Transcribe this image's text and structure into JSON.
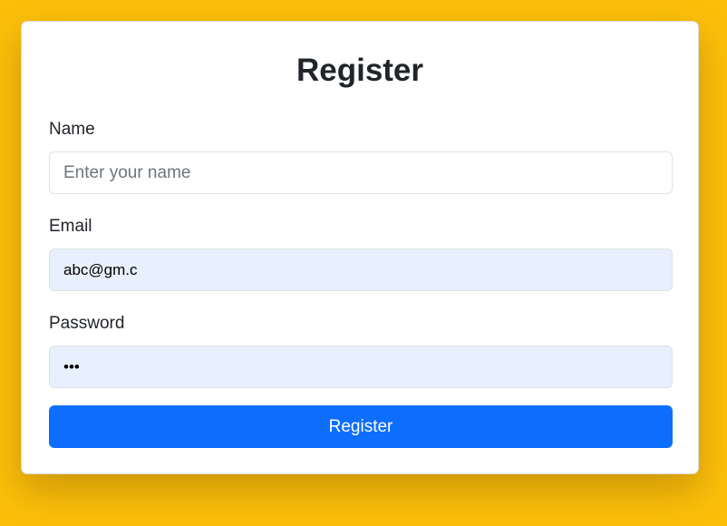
{
  "form": {
    "title": "Register",
    "name_label": "Name",
    "name_placeholder": "Enter your name",
    "email_label": "Email",
    "email_value": "abc@gm.c",
    "password_label": "Password",
    "password_value": "abc",
    "submit_label": "Register"
  },
  "colors": {
    "background": "#fbbf0a",
    "primary": "#0d6efd",
    "autofill": "#e8f0fe"
  }
}
